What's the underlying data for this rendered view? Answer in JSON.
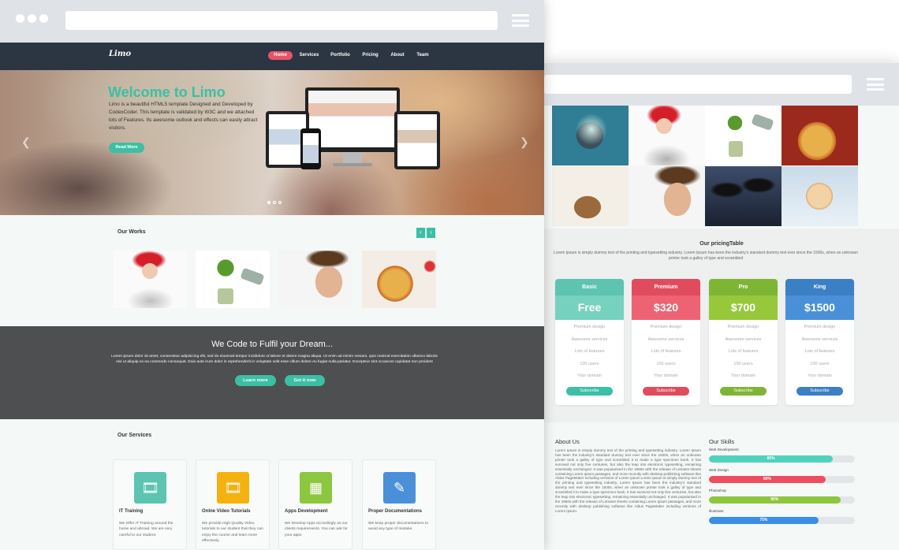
{
  "brand": {
    "logo": "Limo"
  },
  "nav": {
    "items": [
      "Home",
      "Services",
      "Portfolio",
      "Pricing",
      "About",
      "Team"
    ],
    "active": "Home"
  },
  "hero": {
    "title": "Welcome to Limo",
    "text": "Limo is a beautiful HTML5 template Designed and Developed by CodexCoder. This template is validated by W3C and we attached lots of Features. Its awesome outlook and effects can easily attract visitors.",
    "button": "Read More"
  },
  "works": {
    "title": "Our Works"
  },
  "cta": {
    "title": "We Code to Fulfil your Dream...",
    "text": "Lorem ipsum dolor sit amet, consectetur adipisicing elit, sed do eiusmod tempor incididunt ut labore et dolore magna aliqua. Ut enim ad minim veniam, quis nostrud exercitation ullamco laboris nisi ut aliquip ex ea commodo consequat. Duis aute irure dolor in reprehenderit in voluptate velit esse cillum dolore eu fugiat nulla pariatur. Excepteur sint occaecat cupidatat non proident",
    "learn": "Learn more",
    "get": "Get it now"
  },
  "services": {
    "title": "Our Services",
    "items": [
      {
        "title": "IT Training",
        "text": "We Offer IT Training around the home and abroad. We are very careful to our student.",
        "color": "#5cc4b0",
        "icon": "film-icon"
      },
      {
        "title": "Onlne Video Tutorials",
        "text": "We provide High Quality Video tutorials to our student that they can enjoy the course and learn more effectively.",
        "color": "#f5b10f",
        "icon": "film-icon"
      },
      {
        "title": "Apps Development",
        "text": "We Develop Apps accordingly as our clients requirements. You can ask for your apps",
        "color": "#8dc63f",
        "icon": "apps-grid-icon"
      },
      {
        "title": "Proper Documentations",
        "text": "We keep proper documentations to avoid any type of mistake.",
        "color": "#4a90d9",
        "icon": "edit-icon"
      }
    ]
  },
  "pricing": {
    "title": "Our pricingTable",
    "desc": "Lorem Ipsum is simply dummy text of the printing and typesetting industry. Lorem Ipsum has been the industry's standard dummy text ever since the 1500s, when an unknown printer took a galley of type and scrambled",
    "plans": [
      {
        "name": "Basic",
        "price": "Free",
        "head": "#5cc4b0",
        "body": "#76d2bf",
        "btn": "#3bbfa5"
      },
      {
        "name": "Premium",
        "price": "$320",
        "head": "#e14b5e",
        "body": "#ee6374",
        "btn": "#e14b5e"
      },
      {
        "name": "Pro",
        "price": "$700",
        "head": "#7fb534",
        "body": "#97c83c",
        "btn": "#7fb534"
      },
      {
        "name": "King",
        "price": "$1500",
        "head": "#3b80c4",
        "body": "#4a90d9",
        "btn": "#3b80c4"
      }
    ],
    "features": [
      "Premium design",
      "Awesome services",
      "Lots of features",
      "100 users",
      "Your domain"
    ],
    "button": "Subscribe"
  },
  "about": {
    "title": "About Us",
    "text": "Lorem Ipsum is simply dummy text of the printing and typesetting industry. Lorem Ipsum has been the industry's standard dummy text ever since the 1500s, when an unknown printer took a galley of type and scrambled it to make a type specimen book. It has survived not only five centuries, but also the leap into electronic typesetting, remaining essentially unchanged. It was popularised in the 1960s with the release of Letraset sheets containing Lorem Ipsum passages, and more recently with desktop publishing software like Aldus PageMaker including versions of Lorem Ipsum.Lorem Ipsum is simply dummy text of the printing and typesetting industry. Lorem Ipsum has been the industry's standard dummy text ever since the 1500s, when an unknown printer took a galley of type and scrambled it to make a type specimen book. It has survived not only five centuries, but also the leap into electronic typesetting, remaining essentially unchanged. It was popularised in the 1960s with the release of Letraset sheets containing Lorem Ipsum passages, and more recently with desktop publishing software like Aldus PageMaker including versions of Lorem Ipsum."
  },
  "skills": {
    "title": "Our Skills",
    "items": [
      {
        "label": "Web Development",
        "percent": 85,
        "text": "85%",
        "color": "#4fd1bd"
      },
      {
        "label": "Web Design",
        "percent": 80,
        "text": "80%",
        "color": "#ee4d5f"
      },
      {
        "label": "Photoshop",
        "percent": 90,
        "text": "90%",
        "color": "#8dc63f"
      },
      {
        "label": "Illustrator",
        "percent": 75,
        "text": "75%",
        "color": "#3a8ee6"
      }
    ]
  }
}
